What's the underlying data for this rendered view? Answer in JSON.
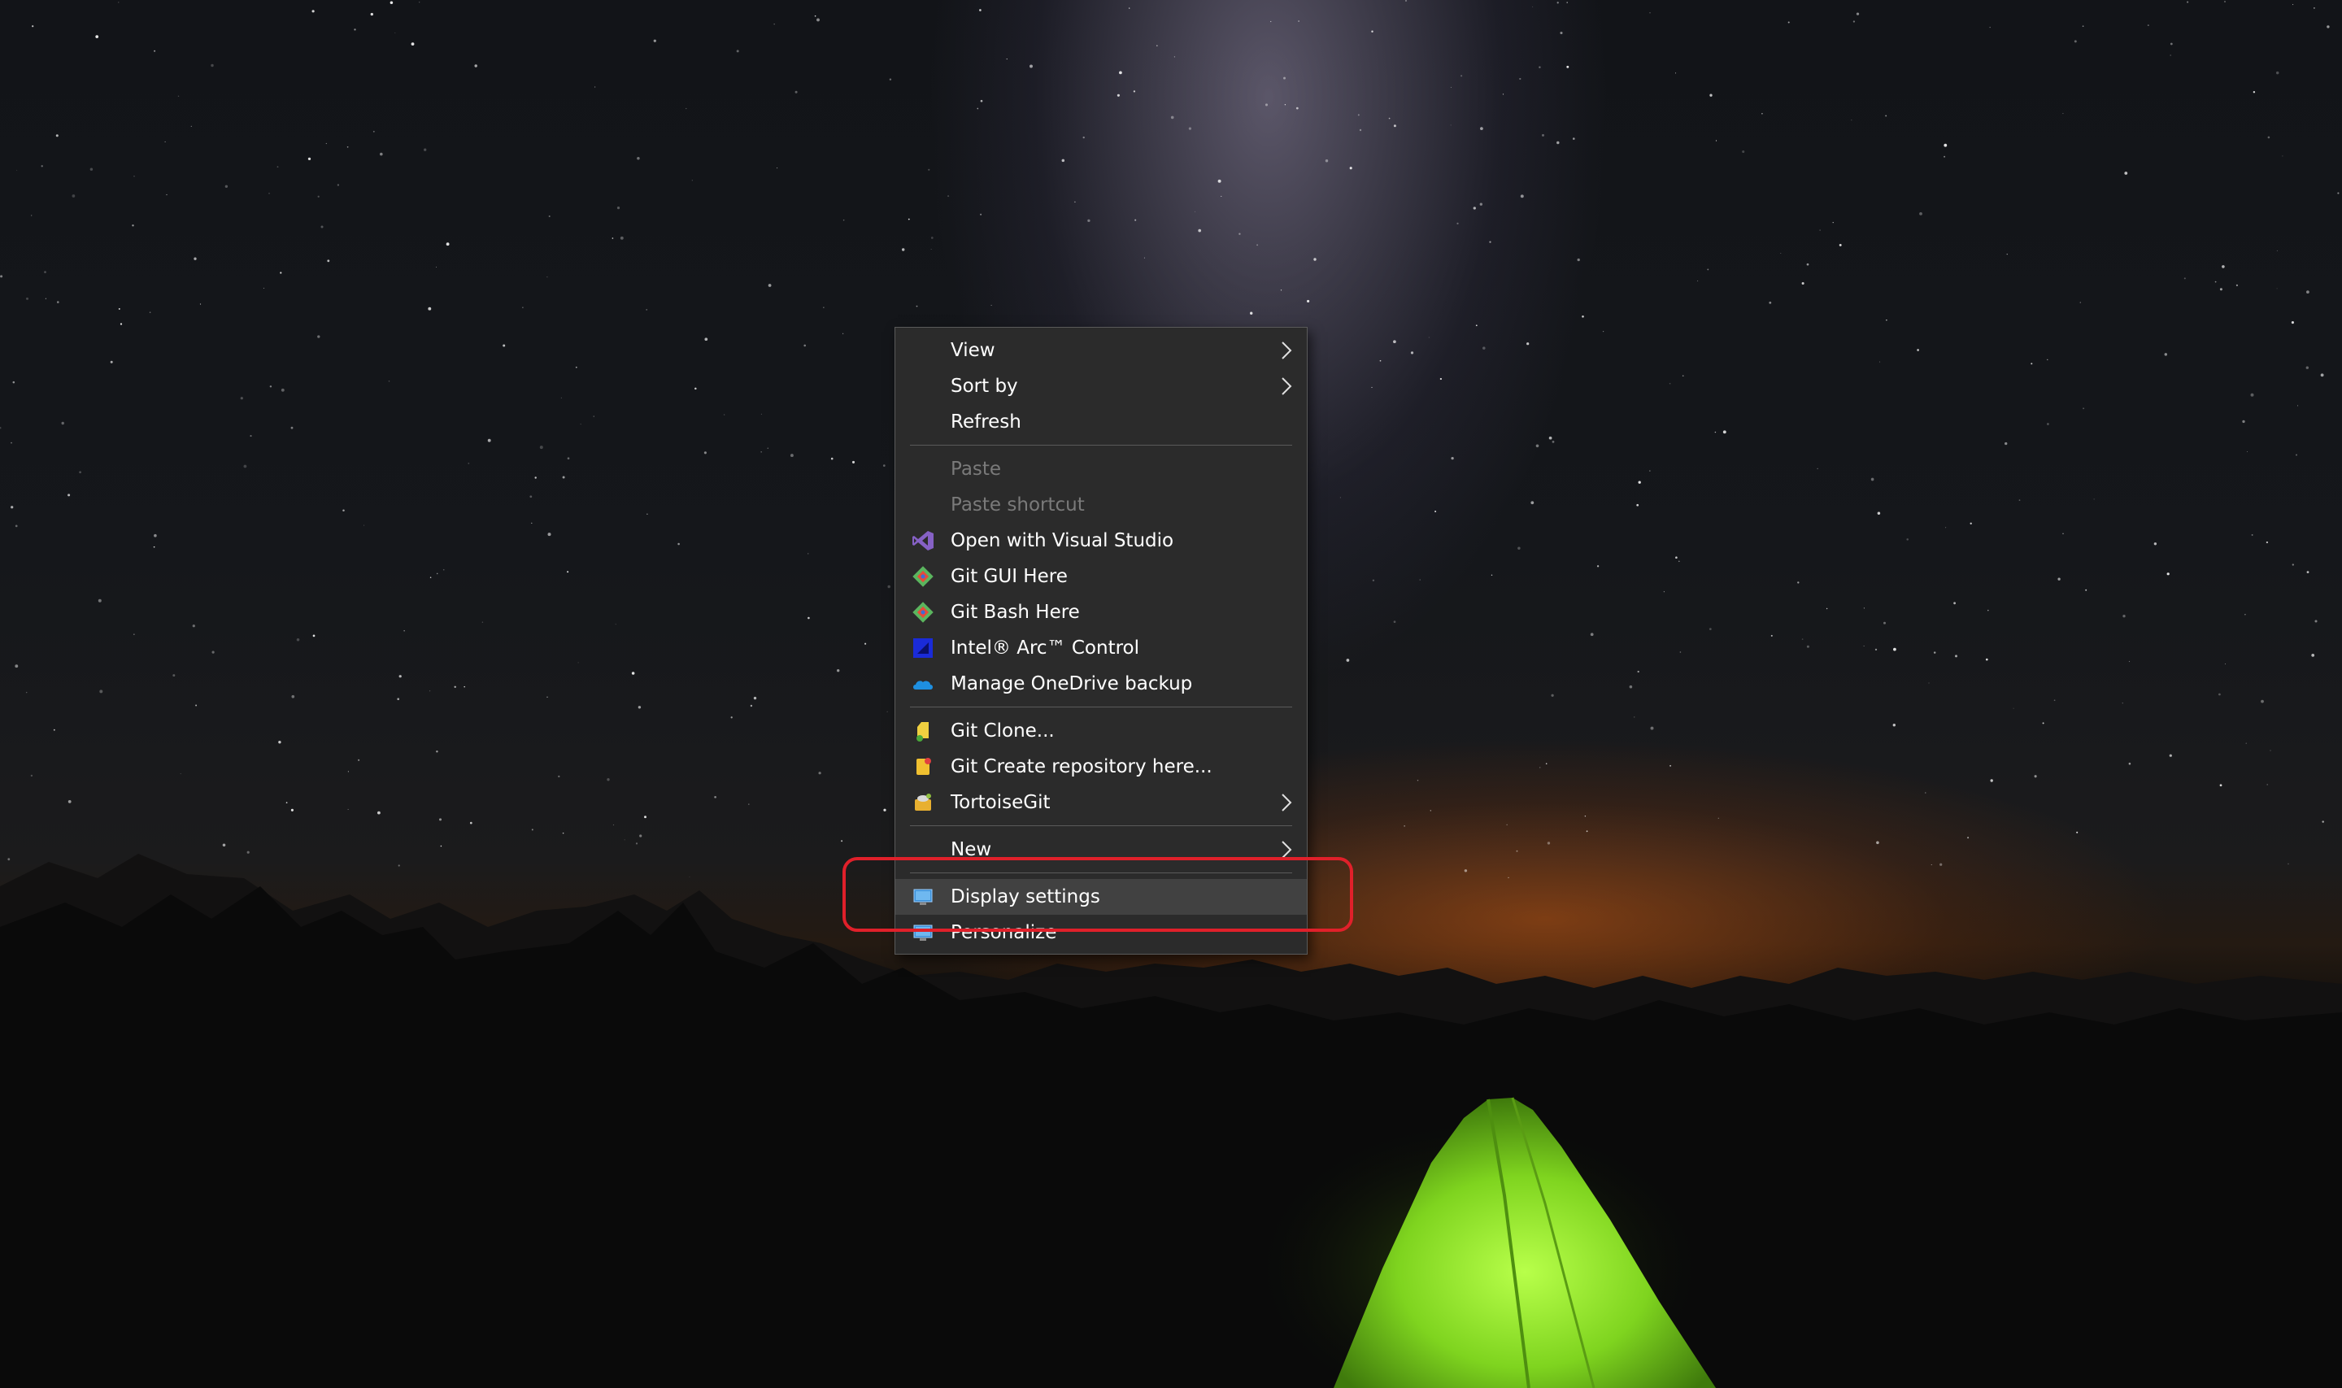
{
  "context_menu": {
    "groups": [
      [
        {
          "label": "View",
          "icon": "",
          "submenu": true,
          "disabled": false
        },
        {
          "label": "Sort by",
          "icon": "",
          "submenu": true,
          "disabled": false
        },
        {
          "label": "Refresh",
          "icon": "",
          "submenu": false,
          "disabled": false
        }
      ],
      [
        {
          "label": "Paste",
          "icon": "",
          "submenu": false,
          "disabled": true
        },
        {
          "label": "Paste shortcut",
          "icon": "",
          "submenu": false,
          "disabled": true
        },
        {
          "label": "Open with Visual Studio",
          "icon": "visual-studio-icon",
          "submenu": false,
          "disabled": false
        },
        {
          "label": "Git GUI Here",
          "icon": "git-gui-icon",
          "submenu": false,
          "disabled": false
        },
        {
          "label": "Git Bash Here",
          "icon": "git-bash-icon",
          "submenu": false,
          "disabled": false
        },
        {
          "label": "Intel® Arc™ Control",
          "icon": "intel-arc-icon",
          "submenu": false,
          "disabled": false
        },
        {
          "label": "Manage OneDrive backup",
          "icon": "onedrive-cloud-icon",
          "submenu": false,
          "disabled": false
        }
      ],
      [
        {
          "label": "Git Clone...",
          "icon": "tortoisegit-clone-icon",
          "submenu": false,
          "disabled": false
        },
        {
          "label": "Git Create repository here...",
          "icon": "tortoisegit-create-repo-icon",
          "submenu": false,
          "disabled": false
        },
        {
          "label": "TortoiseGit",
          "icon": "tortoisegit-icon",
          "submenu": true,
          "disabled": false
        }
      ],
      [
        {
          "label": "New",
          "icon": "",
          "submenu": true,
          "disabled": false
        }
      ],
      [
        {
          "label": "Display settings",
          "icon": "display-settings-icon",
          "submenu": false,
          "disabled": false,
          "hover": true
        },
        {
          "label": "Personalize",
          "icon": "personalize-icon",
          "submenu": false,
          "disabled": false
        }
      ]
    ]
  },
  "colors": {
    "menu_background": "#2b2b2b",
    "menu_border": "#5a5a5a",
    "hover_background": "#414141",
    "disabled_text": "#7a7a7a",
    "highlight_annotation": "#e0202a",
    "tent_green": "#8ee62a"
  }
}
